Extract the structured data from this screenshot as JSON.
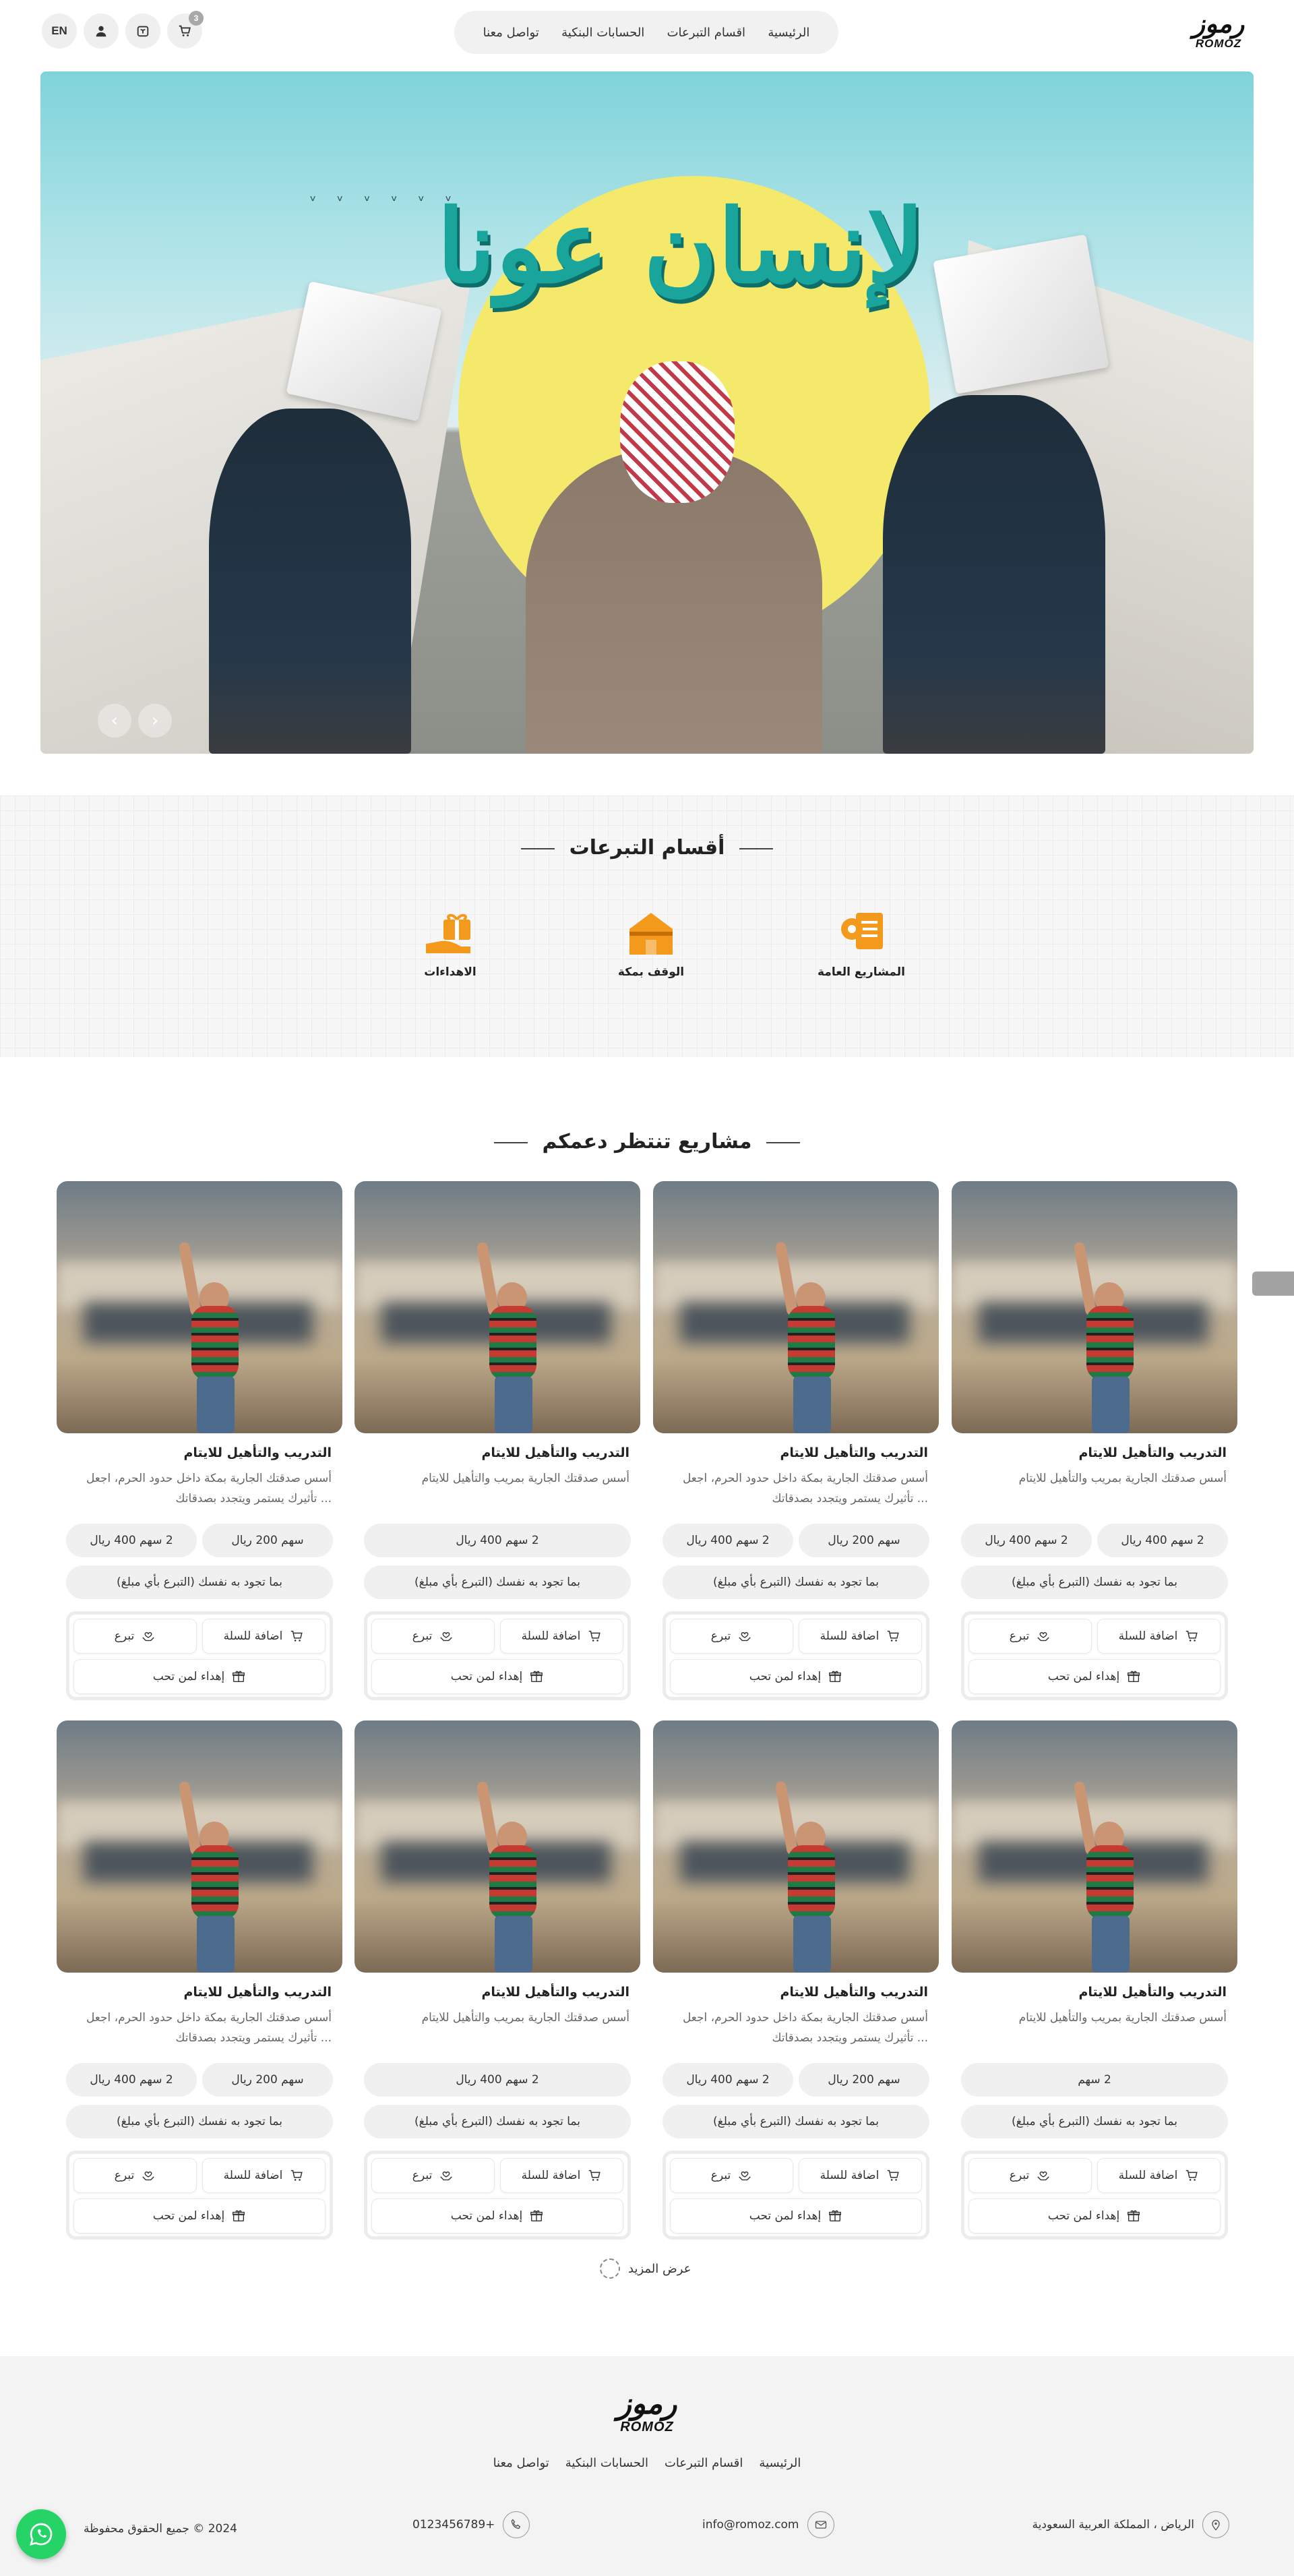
{
  "brand": {
    "logo_ar": "رموز",
    "logo_en": "ROMOZ"
  },
  "nav": {
    "items": [
      {
        "label": "الرئيسية"
      },
      {
        "label": "اقسام التبرعات"
      },
      {
        "label": "الحسابات البنكية"
      },
      {
        "label": "تواصل معنا"
      }
    ]
  },
  "header": {
    "lang_label": "EN",
    "cart_count": "3"
  },
  "hero": {
    "title": "لإنسان عونا"
  },
  "categories": {
    "title": "أقسام التبرعات",
    "items": [
      {
        "label": "المشاريع العامة"
      },
      {
        "label": "الوقف بمكة"
      },
      {
        "label": "الاهداءات"
      }
    ]
  },
  "projects": {
    "title": "مشاريع تنتظر دعمكم",
    "cards": [
      {
        "title": "التدريب والتأهيل للايتام",
        "desc": "أسس صدقتك الجارية بمريب والتأهيل للايتام",
        "price_a": "2 سهم 400 ريال",
        "price_b": "2 سهم 400 ريال"
      },
      {
        "title": "التدريب والتأهيل للايتام",
        "desc": "أسس صدقتك الجارية بمكة داخل حدود الحرم، اجعل تأثيرك يستمر ويتجدد بصدقاتك ...",
        "price_a": "سهم 200 ريال",
        "price_b": "2 سهم 400 ريال"
      },
      {
        "title": "التدريب والتأهيل للايتام",
        "desc": "أسس صدقتك الجارية بمريب والتأهيل للايتام",
        "price_a": "2 سهم 400 ريال",
        "price_b": ""
      },
      {
        "title": "التدريب والتأهيل للايتام",
        "desc": "أسس صدقتك الجارية بمكة داخل حدود الحرم، اجعل تأثيرك يستمر ويتجدد بصدقاتك ...",
        "price_a": "سهم 200 ريال",
        "price_b": "2 سهم 400 ريال"
      },
      {
        "title": "التدريب والتأهيل للايتام",
        "desc": "أسس صدقتك الجارية بمريب والتأهيل للايتام",
        "price_a": "2 سهم",
        "price_b": ""
      },
      {
        "title": "التدريب والتأهيل للايتام",
        "desc": "أسس صدقتك الجارية بمكة داخل حدود الحرم، اجعل تأثيرك يستمر ويتجدد بصدقاتك ...",
        "price_a": "سهم 200 ريال",
        "price_b": "2 سهم 400 ريال"
      },
      {
        "title": "التدريب والتأهيل للايتام",
        "desc": "أسس صدقتك الجارية بمريب والتأهيل للايتام",
        "price_a": "2 سهم 400 ريال",
        "price_b": ""
      },
      {
        "title": "التدريب والتأهيل للايتام",
        "desc": "أسس صدقتك الجارية بمكة داخل حدود الحرم، اجعل تأثيرك يستمر ويتجدد بصدقاتك ...",
        "price_a": "سهم 200 ريال",
        "price_b": "2 سهم 400 ريال"
      }
    ],
    "free_label": "بما تجود به نفسك (التبرع بأي مبلغ)",
    "add_cart_label": "اضافة للسلة",
    "donate_label": "تبرع",
    "gift_label": "إهداء لمن تحب",
    "load_more": "عرض المزيد"
  },
  "footer": {
    "nav": [
      {
        "label": "الرئيسية"
      },
      {
        "label": "اقسام التبرعات"
      },
      {
        "label": "الحسابات البنكية"
      },
      {
        "label": "تواصل معنا"
      }
    ],
    "address": "الرياض ، المملكة العربية السعودية",
    "email": "info@romoz.com",
    "phone": "0123456789+",
    "copyright": "2024 © جميع الحقوق محفوظة"
  },
  "colors": {
    "accent": "#f39a1d",
    "hero_title": "#1aa59c",
    "whatsapp": "#25d366"
  }
}
